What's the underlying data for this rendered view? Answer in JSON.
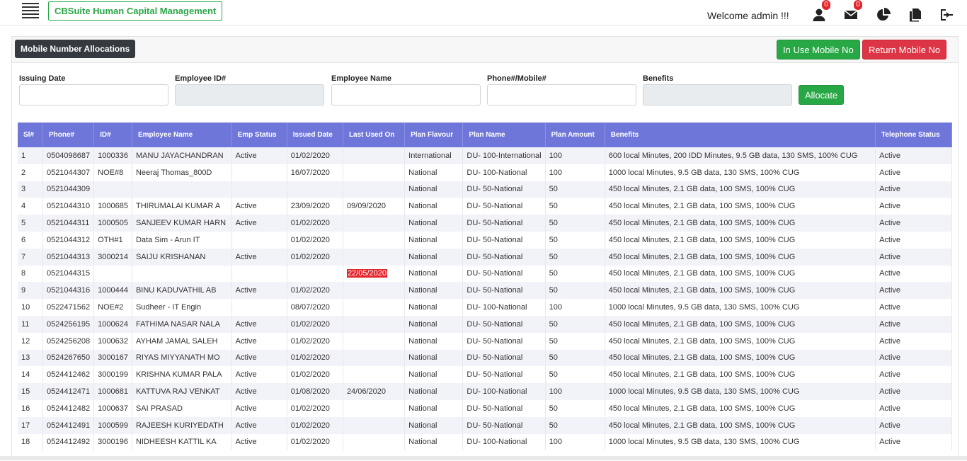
{
  "app": {
    "brand": "CBSuite Human Capital Management",
    "welcome": "Welcome admin !!!",
    "user_badge": "0",
    "mail_badge": "0"
  },
  "panel": {
    "title": "Mobile Number Allocations",
    "in_use_label": "In Use Mobile No",
    "return_label": "Return Mobile No",
    "allocate_label": "Allocate"
  },
  "form": {
    "issuing_date_label": "Issuing Date",
    "employee_id_label": "Employee ID#",
    "employee_name_label": "Employee Name",
    "phone_label": "Phone#/Mobile#",
    "benefits_label": "Benefits"
  },
  "table": {
    "headers": [
      "Sl#",
      "Phone#",
      "ID#",
      "Employee Name",
      "Emp Status",
      "Issued Date",
      "Last Used On",
      "Plan Flavour",
      "Plan Name",
      "Plan Amount",
      "Benefits",
      "Telephone Status"
    ],
    "rows": [
      [
        "1",
        "0504098687",
        "1000336",
        "MANU JAYACHANDRAN",
        "Active",
        "01/02/2020",
        "",
        "International",
        "DU- 100-International",
        "100",
        "600 local Minutes, 200 IDD Minutes, 9.5 GB data, 130 SMS, 100% CUG",
        "Active"
      ],
      [
        "2",
        "0521044307",
        "NOE#8",
        "Neeraj Thomas_800D",
        "",
        "16/07/2020",
        "",
        "National",
        "DU- 100-National",
        "100",
        "1000 local Minutes, 9.5 GB data, 130 SMS, 100% CUG",
        "Active"
      ],
      [
        "3",
        "0521044309",
        "",
        "",
        "",
        "",
        "",
        "National",
        "DU- 50-National",
        "50",
        "450 local Minutes, 2.1 GB data, 100 SMS, 100% CUG",
        "Active"
      ],
      [
        "4",
        "0521044310",
        "1000685",
        "THIRUMALAI KUMAR A",
        "Active",
        "23/09/2020",
        "09/09/2020",
        "National",
        "DU- 50-National",
        "50",
        "450 local Minutes, 2.1 GB data, 100 SMS, 100% CUG",
        "Active"
      ],
      [
        "5",
        "0521044311",
        "1000505",
        "SANJEEV KUMAR HARN",
        "Active",
        "01/02/2020",
        "",
        "National",
        "DU- 50-National",
        "50",
        "450 local Minutes, 2.1 GB data, 100 SMS, 100% CUG",
        "Active"
      ],
      [
        "6",
        "0521044312",
        "OTH#1",
        "Data Sim - Arun IT",
        "",
        "01/02/2020",
        "",
        "National",
        "DU- 50-National",
        "50",
        "450 local Minutes, 2.1 GB data, 100 SMS, 100% CUG",
        "Active"
      ],
      [
        "7",
        "0521044313",
        "3000214",
        "SAIJU KRISHANAN",
        "Active",
        "01/02/2020",
        "",
        "National",
        "DU- 50-National",
        "50",
        "450 local Minutes, 2.1 GB data, 100 SMS, 100% CUG",
        "Active"
      ],
      [
        "8",
        "0521044315",
        "",
        "",
        "",
        "",
        "22/05/2020",
        "National",
        "DU- 50-National",
        "50",
        "450 local Minutes, 2.1 GB data, 100 SMS, 100% CUG",
        "Active"
      ],
      [
        "9",
        "0521044316",
        "1000444",
        "BINU KADUVATHIL AB",
        "Active",
        "01/02/2020",
        "",
        "National",
        "DU- 50-National",
        "50",
        "450 local Minutes, 2.1 GB data, 100 SMS, 100% CUG",
        "Active"
      ],
      [
        "10",
        "0522471562",
        "NOE#2",
        "Sudheer - IT Engin",
        "",
        "08/07/2020",
        "",
        "National",
        "DU- 100-National",
        "100",
        "1000 local Minutes, 9.5 GB data, 130 SMS, 100% CUG",
        "Active"
      ],
      [
        "11",
        "0524256195",
        "1000624",
        "FATHIMA NASAR NALA",
        "Active",
        "01/02/2020",
        "",
        "National",
        "DU- 50-National",
        "50",
        "450 local Minutes, 2.1 GB data, 100 SMS, 100% CUG",
        "Active"
      ],
      [
        "12",
        "0524256208",
        "1000632",
        "AYHAM JAMAL SALEH",
        "Active",
        "01/02/2020",
        "",
        "National",
        "DU- 50-National",
        "50",
        "450 local Minutes, 2.1 GB data, 100 SMS, 100% CUG",
        "Active"
      ],
      [
        "13",
        "0524267650",
        "3000167",
        "RIYAS MIYYANATH MO",
        "Active",
        "01/02/2020",
        "",
        "National",
        "DU- 50-National",
        "50",
        "450 local Minutes, 2.1 GB data, 100 SMS, 100% CUG",
        "Active"
      ],
      [
        "14",
        "0524412462",
        "3000199",
        "KRISHNA KUMAR PALA",
        "Active",
        "01/02/2020",
        "",
        "National",
        "DU- 50-National",
        "50",
        "450 local Minutes, 2.1 GB data, 100 SMS, 100% CUG",
        "Active"
      ],
      [
        "15",
        "0524412471",
        "1000681",
        "KATTUVA RAJ VENKAT",
        "Active",
        "01/08/2020",
        "24/06/2020",
        "National",
        "DU- 100-National",
        "100",
        "1000 local Minutes, 9.5 GB data, 130 SMS, 100% CUG",
        "Active"
      ],
      [
        "16",
        "0524412482",
        "1000637",
        "SAI PRASAD",
        "Active",
        "01/02/2020",
        "",
        "National",
        "DU- 50-National",
        "50",
        "450 local Minutes, 2.1 GB data, 100 SMS, 100% CUG",
        "Active"
      ],
      [
        "17",
        "0524412491",
        "1000599",
        "RAJEESH KURIYEDATH",
        "Active",
        "01/02/2020",
        "",
        "National",
        "DU- 50-National",
        "50",
        "450 local Minutes, 2.1 GB data, 100 SMS, 100% CUG",
        "Active"
      ],
      [
        "18",
        "0524412492",
        "3000196",
        "NIDHEESH KATTIL KA",
        "Active",
        "01/02/2020",
        "",
        "National",
        "DU- 100-National",
        "100",
        "1000 local Minutes, 9.5 GB data, 130 SMS, 100% CUG",
        "Active"
      ]
    ],
    "highlighted_cell": {
      "row": 7,
      "col": 6,
      "color": "#e3242b"
    }
  },
  "colors": {
    "accent_green": "#28a745",
    "accent_red": "#dc3545",
    "table_header": "#6f76d9",
    "title_dark": "#343a40"
  },
  "icons": [
    "menu-icon",
    "user-icon",
    "mail-icon",
    "pie-chart-icon",
    "copy-icon",
    "sign-out-icon"
  ]
}
